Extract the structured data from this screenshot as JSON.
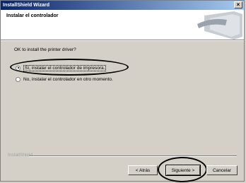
{
  "window": {
    "title": "InstallShield Wizard",
    "close_glyph": "×"
  },
  "header": {
    "title": "Instalar el controlador"
  },
  "prompt": "OK to install the printer driver?",
  "options": [
    {
      "label": "Sí, instalar el controlador de impresora.",
      "selected": true
    },
    {
      "label": "No, instalar el controlador en otro momento.",
      "selected": false
    }
  ],
  "footer": {
    "brand": "InstallShield"
  },
  "buttons": {
    "back": "< Atrás",
    "next": "Siguiente >",
    "cancel": "Cancelar"
  }
}
